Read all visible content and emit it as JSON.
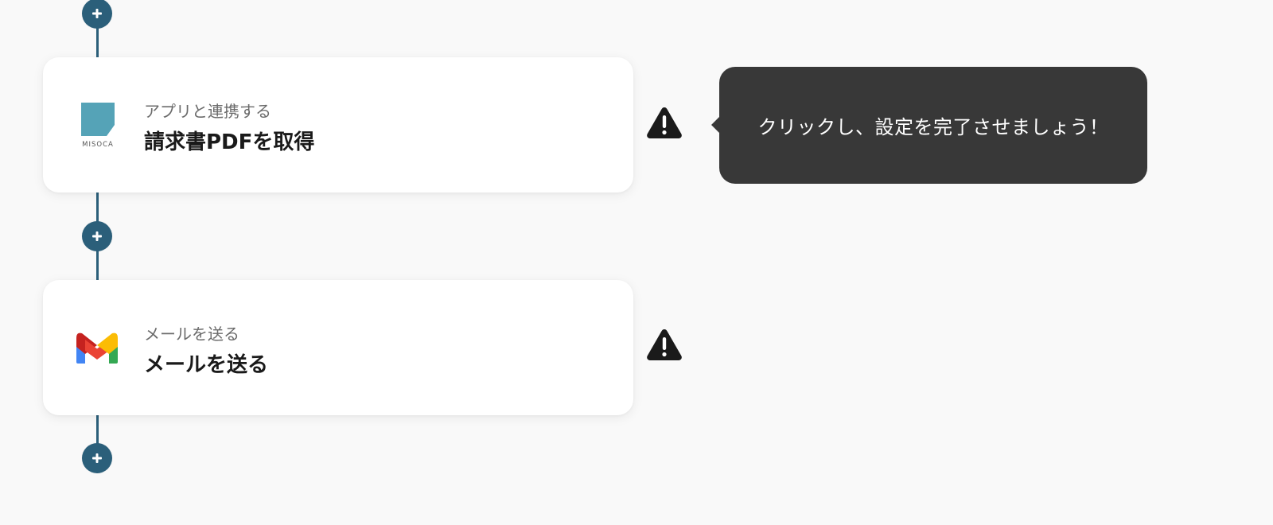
{
  "flow": {
    "steps": [
      {
        "app": "Misoca",
        "logo_text": "MISOCA",
        "subtitle": "アプリと連携する",
        "title": "請求書PDFを取得",
        "status": "incomplete",
        "icon": "misoca-logo-icon"
      },
      {
        "app": "Gmail",
        "subtitle": "メールを送る",
        "title": "メールを送る",
        "status": "incomplete",
        "icon": "gmail-logo-icon"
      }
    ],
    "add_step_icon": "plus-icon",
    "warning_icon": "warning-triangle-icon"
  },
  "tooltip": {
    "text": "クリックし、設定を完了させましょう！"
  },
  "colors": {
    "background": "#f9f9f9",
    "connector": "#2b5f7a",
    "add_button": "#2b5f7a",
    "card": "#ffffff",
    "tooltip_bg": "#383838",
    "warning": "#1a1a1a",
    "misoca_teal": "#55a3b7"
  }
}
